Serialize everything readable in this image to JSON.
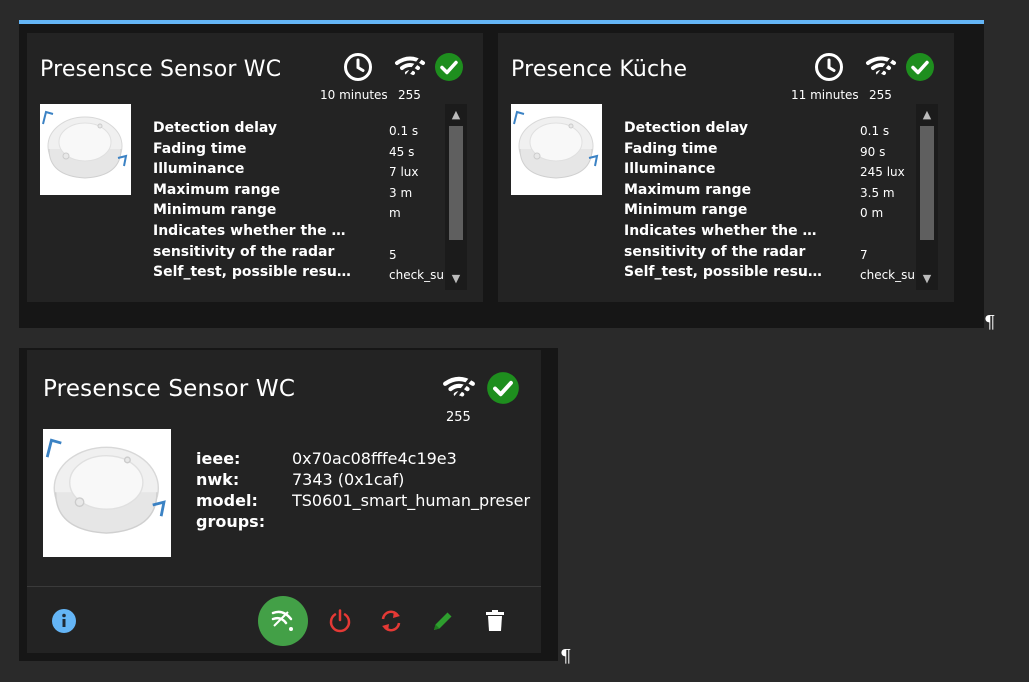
{
  "cards": [
    {
      "title": "Presensce Sensor WC",
      "last_seen": "10 minutes",
      "link_quality": "255",
      "attributes": [
        {
          "label": "Detection delay",
          "value": "0.1 s"
        },
        {
          "label": "Fading time",
          "value": "45 s"
        },
        {
          "label": "Illuminance",
          "value": "7 lux"
        },
        {
          "label": "Maximum range",
          "value": "3 m"
        },
        {
          "label": "Minimum range",
          "value": " m"
        },
        {
          "label": "Indicates whether the de…",
          "value": ""
        },
        {
          "label": "sensitivity of the radar",
          "value": "5"
        },
        {
          "label": "Self_test, possible resuts…",
          "value": "check_su"
        }
      ]
    },
    {
      "title": "Presence Küche",
      "last_seen": "11 minutes",
      "link_quality": "255",
      "attributes": [
        {
          "label": "Detection delay",
          "value": "0.1 s"
        },
        {
          "label": "Fading time",
          "value": "90 s"
        },
        {
          "label": "Illuminance",
          "value": "245 lux"
        },
        {
          "label": "Maximum range",
          "value": "3.5 m"
        },
        {
          "label": "Minimum range",
          "value": "0 m"
        },
        {
          "label": "Indicates whether the de…",
          "value": ""
        },
        {
          "label": "sensitivity of the radar",
          "value": "7"
        },
        {
          "label": "Self_test, possible resuts…",
          "value": "check_su"
        }
      ]
    }
  ],
  "detail": {
    "title": "Presensce Sensor WC",
    "link_quality": "255",
    "info": [
      {
        "key": "ieee:",
        "value": "0x70ac08fffe4c19e3"
      },
      {
        "key": "nwk:",
        "value": "7343 (0x1caf)"
      },
      {
        "key": "model:",
        "value": "TS0601_smart_human_preser"
      },
      {
        "key": "groups:",
        "value": ""
      }
    ],
    "actions": [
      "info-icon",
      "pairing-button",
      "power-icon",
      "reconfigure-icon",
      "edit-icon",
      "delete-icon"
    ]
  },
  "pilcrow": "¶",
  "colors": {
    "accent": "#64b5f6",
    "ok_green": "#1e8e1e",
    "pair_green": "#43a047",
    "red": "#e53935",
    "edit_green": "#2e9e2e",
    "info_blue": "#64b5f6"
  }
}
